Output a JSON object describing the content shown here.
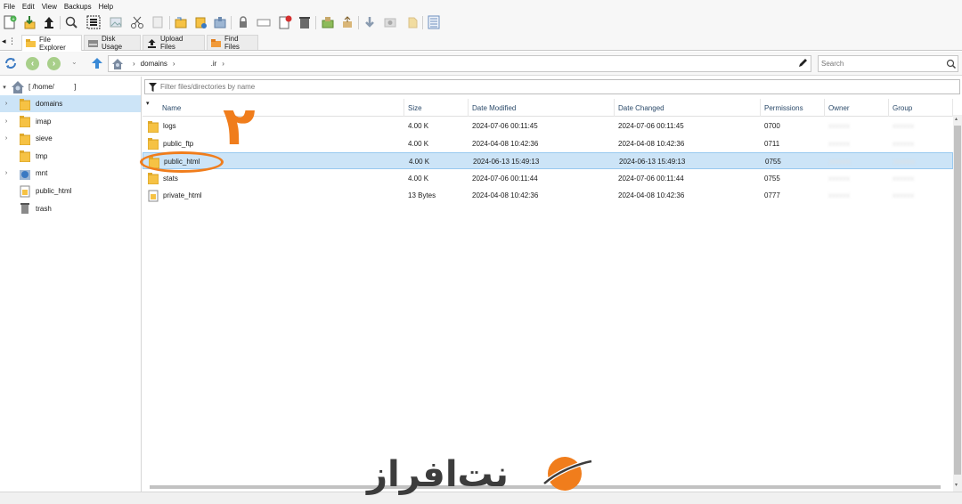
{
  "menu": [
    "File",
    "Edit",
    "View",
    "Backups",
    "Help"
  ],
  "tabs": [
    {
      "label": "File Explorer",
      "active": true
    },
    {
      "label": "Disk Usage",
      "active": false
    },
    {
      "label": "Upload Files",
      "active": false
    },
    {
      "label": "Find Files",
      "active": false
    }
  ],
  "address": {
    "breadcrumb": [
      "domains",
      ".ir"
    ],
    "search_placeholder": "Search"
  },
  "tree": {
    "root_label": "[ /home/          ]",
    "items": [
      {
        "label": "domains",
        "icon": "folder-icon",
        "expandable": true,
        "selected": true
      },
      {
        "label": "imap",
        "icon": "folder-icon",
        "expandable": true,
        "selected": false
      },
      {
        "label": "sieve",
        "icon": "folder-icon",
        "expandable": true,
        "selected": false
      },
      {
        "label": "tmp",
        "icon": "folder-icon",
        "expandable": false,
        "selected": false
      },
      {
        "label": "mnt",
        "icon": "globe-folder-icon",
        "expandable": true,
        "selected": false
      },
      {
        "label": "public_html",
        "icon": "link-file-icon",
        "expandable": false,
        "selected": false
      },
      {
        "label": "trash",
        "icon": "trash-icon",
        "expandable": false,
        "selected": false
      }
    ]
  },
  "filter": {
    "placeholder": "Filter files/directories by name"
  },
  "columns": [
    "Name",
    "Size",
    "Date Modified",
    "Date Changed",
    "Permissions",
    "Owner",
    "Group"
  ],
  "files": [
    {
      "name": "logs",
      "size": "4.00 K",
      "modified": "2024-07-06 00:11:45",
      "changed": "2024-07-06 00:11:45",
      "perms": "0700",
      "owner": "xxxxxx",
      "group": "xxxxxx",
      "icon": "folder-icon",
      "selected": false
    },
    {
      "name": "public_ftp",
      "size": "4.00 K",
      "modified": "2024-04-08 10:42:36",
      "changed": "2024-04-08 10:42:36",
      "perms": "0711",
      "owner": "xxxxxx",
      "group": "xxxxxx",
      "icon": "folder-icon",
      "selected": false
    },
    {
      "name": "public_html",
      "size": "4.00 K",
      "modified": "2024-06-13 15:49:13",
      "changed": "2024-06-13 15:49:13",
      "perms": "0755",
      "owner": "xxxxxx",
      "group": "xxxxxx",
      "icon": "folder-icon",
      "selected": true
    },
    {
      "name": "stats",
      "size": "4.00 K",
      "modified": "2024-07-06 00:11:44",
      "changed": "2024-07-06 00:11:44",
      "perms": "0755",
      "owner": "xxxxxx",
      "group": "xxxxxx",
      "icon": "folder-icon",
      "selected": false
    },
    {
      "name": "private_html",
      "size": "13 Bytes",
      "modified": "2024-04-08 10:42:36",
      "changed": "2024-04-08 10:42:36",
      "perms": "0777",
      "owner": "xxxxxx",
      "group": "xxxxxx",
      "icon": "link-file-icon",
      "selected": false
    }
  ],
  "annotation": {
    "number": "۲",
    "color": "#f07d1c"
  },
  "logo": {
    "text": "نت‌افراز",
    "accent": "#f07d1c"
  },
  "colors": {
    "selection": "#cce4f7",
    "folder": "#f6c244",
    "accent": "#f07d1c"
  }
}
